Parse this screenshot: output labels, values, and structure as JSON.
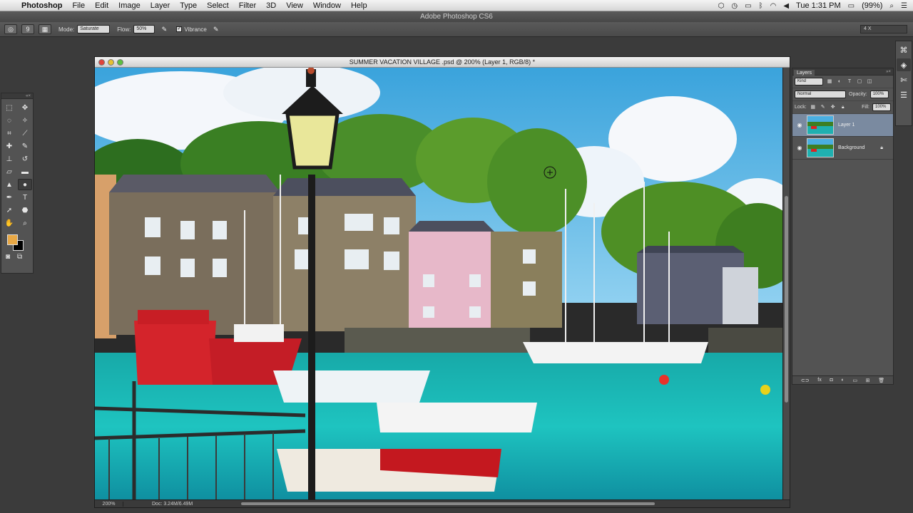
{
  "menubar": {
    "apple_icon": "apple-icon",
    "app_name": "Photoshop",
    "items": [
      "File",
      "Edit",
      "Image",
      "Layer",
      "Type",
      "Select",
      "Filter",
      "3D",
      "View",
      "Window",
      "Help"
    ],
    "clock": "Tue 1:31 PM",
    "battery": "(99%)"
  },
  "app_title": "Adobe Photoshop CS6",
  "options": {
    "brush_size": "9",
    "mode_label": "Mode:",
    "mode_value": "Saturate",
    "flow_label": "Flow:",
    "flow_value": "50%",
    "vibrance_label": "Vibrance",
    "workspace": "4 X"
  },
  "document": {
    "title": "SUMMER VACATION VILLAGE .psd @ 200% (Layer 1, RGB/8) *",
    "zoom": "200%",
    "doc_size": "Doc: 3.24M/6.49M"
  },
  "layers_panel": {
    "tab": "Layers",
    "filter_kind": "Kind",
    "blend_mode": "Normal",
    "opacity_label": "Opacity:",
    "opacity_value": "100%",
    "lock_label": "Lock:",
    "fill_label": "Fill:",
    "fill_value": "100%",
    "layers": [
      {
        "name": "Layer 1",
        "selected": true
      },
      {
        "name": "Background",
        "selected": false
      }
    ]
  },
  "colors": {
    "foreground": "#e8a845",
    "background": "#000000"
  }
}
